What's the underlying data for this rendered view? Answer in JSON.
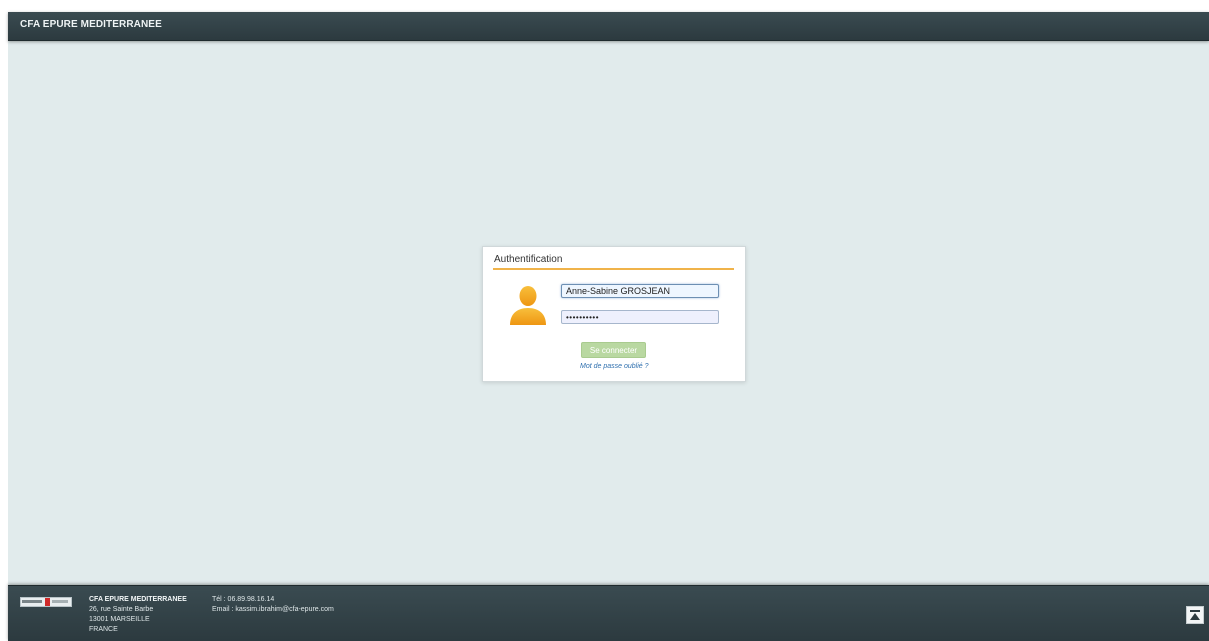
{
  "header": {
    "title": "CFA EPURE MEDITERRANEE"
  },
  "login": {
    "title": "Authentification",
    "username_value": "Anne-Sabine GROSJEAN",
    "password_value": "••••••••••",
    "submit_label": "Se connecter",
    "forgot_label": "Mot de passe oublié ?",
    "avatar_icon": "user-icon"
  },
  "footer": {
    "org_name": "CFA EPURE MEDITERRANEE",
    "address_line1": "26, rue Sainte Barbe",
    "address_line2": "13001 MARSEILLE",
    "country": "FRANCE",
    "phone": "Tél : 06.89.98.16.14",
    "email": "Email : kassim.ibrahim@cfa-epure.com",
    "scroll_icon": "arrow-up-to-top-icon"
  },
  "colors": {
    "bar": "#34444a",
    "background": "#e1ebec",
    "accent_underline": "#f0b34a",
    "button": "#b9d8a1",
    "link": "#2e6fae",
    "avatar": "#f4a81d"
  }
}
